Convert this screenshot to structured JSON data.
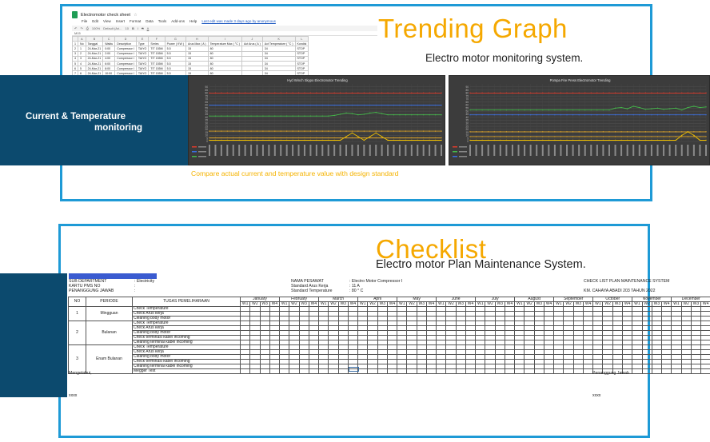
{
  "trending": {
    "title": "Trending Graph",
    "subtitle": "Electro motor monitoring system.",
    "panel_line1": "Current & Temperature",
    "panel_line2": "monitoring",
    "compare_text": "Compare actual current and temperature value with design standard",
    "spreadsheet": {
      "file_title": "Electromotor check sheet",
      "menu": [
        "File",
        "Edit",
        "View",
        "Insert",
        "Format",
        "Data",
        "Tools",
        "Add-ons",
        "Help"
      ],
      "last_edit": "Last edit was made 3 days ago by anonymous",
      "zoom": "100%",
      "font": "Default (Ari...",
      "font_size": "10",
      "cell_ref": "M15",
      "col_letters": [
        "",
        "A",
        "B",
        "C",
        "D",
        "E",
        "F",
        "G",
        "H",
        "I",
        "J",
        "K",
        "L"
      ],
      "headers": [
        "No",
        "Tanggal",
        "Waktu",
        "Description",
        "Type",
        "Series",
        "Power ( KW )",
        "Arus Max ( A )",
        "Temperature Max ( °C )",
        "Act Arus ( A )",
        "Act Temperature ( °C )",
        "Kondisi"
      ],
      "rows": [
        [
          "1",
          "24-Mar-21",
          "0:00",
          "Compressor I",
          "TAIYO",
          "TIT 155M",
          "5.5",
          "15",
          "80",
          "",
          "34",
          "STOP"
        ],
        [
          "2",
          "24-Mar-21",
          "2:00",
          "Compressor I",
          "TAIYO",
          "TIT 155M",
          "5.5",
          "15",
          "80",
          "",
          "34",
          "STOP"
        ],
        [
          "3",
          "24-Mar-21",
          "4:00",
          "Compressor I",
          "TAIYO",
          "TIT 155M",
          "5.5",
          "15",
          "80",
          "",
          "34",
          "STOP"
        ],
        [
          "4",
          "24-Mar-21",
          "6:00",
          "Compressor I",
          "TAIYO",
          "TIT 155M",
          "5.5",
          "15",
          "80",
          "",
          "34",
          "STOP"
        ],
        [
          "5",
          "24-Mar-21",
          "8:00",
          "Compressor I",
          "TAIYO",
          "TIT 155M",
          "5.5",
          "15",
          "80",
          "",
          "34",
          "STOP"
        ],
        [
          "6",
          "24-Mar-21",
          "10:00",
          "Compressor I",
          "TAIYO",
          "TIT 155M",
          "5.5",
          "15",
          "80",
          "",
          "34",
          "STOP"
        ]
      ]
    },
    "charts": [
      {
        "title": "Hyd Winch Skypo Electromotor Trending"
      },
      {
        "title": "Pompa Fire Press Electromotor Trending"
      }
    ]
  },
  "chart_data": [
    {
      "type": "line",
      "title": "Hyd Winch Skypo Electromotor Trending",
      "ylim": [
        0,
        95
      ],
      "y_ticks": [
        0,
        5,
        10,
        15,
        20,
        25,
        30,
        35,
        40,
        45,
        50,
        55,
        60,
        65,
        70,
        75,
        80,
        85,
        90
      ],
      "series": [
        {
          "color": "#e03b2b",
          "values": [
            80,
            80,
            80,
            80,
            80,
            80,
            80,
            80,
            80,
            80,
            80,
            80,
            80,
            80,
            80,
            80,
            80,
            80,
            80,
            80,
            80,
            80,
            80,
            80,
            80,
            80,
            80,
            80,
            80,
            80,
            80,
            80,
            80,
            80,
            80,
            80,
            80,
            80,
            80,
            80
          ]
        },
        {
          "color": "#3a6fe0",
          "values": [
            60,
            60,
            60,
            60,
            60,
            60,
            60,
            60,
            60,
            60,
            60,
            60,
            60,
            60,
            60,
            60,
            60,
            60,
            60,
            60,
            60,
            60,
            60,
            60,
            60,
            60,
            60,
            60,
            60,
            60,
            60,
            60,
            60,
            60,
            60,
            60,
            60,
            60,
            60,
            60
          ]
        },
        {
          "color": "#44b94a",
          "values": [
            42,
            42,
            42,
            42,
            42,
            42,
            42,
            42,
            42,
            42,
            42,
            42,
            42,
            42,
            42,
            42,
            42,
            42,
            42,
            42,
            42,
            43,
            45,
            47,
            46,
            44,
            45,
            47,
            48,
            46,
            44,
            44,
            44,
            44,
            44,
            44,
            44,
            44,
            44,
            44
          ]
        },
        {
          "color": "#d9a12a",
          "values": [
            17,
            17,
            17,
            17,
            17,
            17,
            17,
            17,
            17,
            17,
            17,
            17,
            17,
            17,
            17,
            17,
            17,
            17,
            17,
            17,
            17,
            17,
            17,
            17,
            17,
            17,
            17,
            17,
            17,
            17,
            17,
            17,
            17,
            17,
            17,
            17,
            17,
            17,
            17,
            17
          ]
        },
        {
          "color": "#d9a12a",
          "values": [
            6,
            6,
            6,
            6,
            6,
            6,
            6,
            6,
            6,
            6,
            6,
            6,
            6,
            6,
            6,
            6,
            6,
            6,
            6,
            6,
            6,
            6,
            6,
            6,
            6,
            6,
            6,
            6,
            6,
            6,
            6,
            6,
            6,
            6,
            6,
            6,
            6,
            6,
            6,
            6
          ]
        },
        {
          "color": "#f0c000",
          "values": [
            2,
            2,
            2,
            2,
            2,
            2,
            2,
            2,
            2,
            2,
            2,
            2,
            2,
            2,
            2,
            2,
            2,
            2,
            2,
            2,
            2,
            2,
            2,
            8,
            14,
            8,
            2,
            8,
            14,
            8,
            2,
            2,
            2,
            2,
            2,
            2,
            2,
            2,
            2,
            2
          ]
        }
      ]
    },
    {
      "type": "line",
      "title": "Pompa Fire Press Electromotor Trending",
      "ylim": [
        0,
        95
      ],
      "y_ticks": [
        0,
        5,
        10,
        15,
        20,
        25,
        30,
        35,
        40,
        45,
        50,
        55,
        60,
        65,
        70,
        75,
        80,
        85,
        90
      ],
      "series": [
        {
          "color": "#e03b2b",
          "values": [
            80,
            80,
            80,
            80,
            80,
            80,
            80,
            80,
            80,
            80,
            80,
            80,
            80,
            80,
            80,
            80,
            80,
            80,
            80,
            80,
            80,
            80,
            80,
            80,
            80,
            80,
            80,
            80,
            80,
            80,
            80,
            80,
            80,
            80,
            80,
            80,
            80,
            80,
            80,
            80
          ]
        },
        {
          "color": "#44b94a",
          "values": [
            52,
            52,
            52,
            52,
            52,
            52,
            52,
            52,
            52,
            52,
            52,
            52,
            52,
            52,
            52,
            52,
            52,
            52,
            52,
            52,
            52,
            52,
            52,
            52,
            55,
            56,
            54,
            58,
            56,
            53,
            54,
            55,
            53,
            54,
            55,
            52,
            56,
            58,
            56,
            57
          ]
        },
        {
          "color": "#3a6fe0",
          "values": [
            44,
            44,
            44,
            44,
            44,
            44,
            44,
            44,
            44,
            44,
            44,
            44,
            44,
            44,
            44,
            44,
            44,
            44,
            44,
            44,
            44,
            44,
            44,
            44,
            44,
            44,
            44,
            44,
            44,
            44,
            44,
            44,
            44,
            44,
            44,
            44,
            44,
            44,
            44,
            44
          ]
        },
        {
          "color": "#d9a12a",
          "values": [
            16,
            16,
            16,
            16,
            16,
            16,
            16,
            16,
            16,
            16,
            16,
            16,
            16,
            16,
            16,
            16,
            16,
            16,
            16,
            16,
            16,
            16,
            16,
            16,
            16,
            16,
            16,
            16,
            16,
            16,
            16,
            16,
            16,
            16,
            16,
            16,
            16,
            16,
            16,
            16
          ]
        },
        {
          "color": "#d9a12a",
          "values": [
            8,
            8,
            8,
            8,
            8,
            8,
            8,
            8,
            8,
            8,
            8,
            8,
            8,
            8,
            8,
            8,
            8,
            8,
            8,
            8,
            8,
            8,
            8,
            8,
            8,
            8,
            8,
            8,
            8,
            8,
            8,
            8,
            8,
            8,
            8,
            8,
            8,
            8,
            8,
            8
          ]
        },
        {
          "color": "#f0c000",
          "values": [
            2,
            2,
            2,
            2,
            2,
            2,
            2,
            2,
            2,
            2,
            2,
            2,
            2,
            2,
            2,
            2,
            2,
            2,
            2,
            2,
            2,
            2,
            2,
            2,
            2,
            2,
            2,
            2,
            2,
            2,
            2,
            2,
            2,
            2,
            2,
            10,
            16,
            10,
            2,
            2
          ]
        }
      ]
    }
  ],
  "checklist": {
    "title": "Checklist",
    "subtitle": "Electro motor Plan Maintenance System.",
    "header_left": [
      {
        "label": "SUB DEPARTMENT",
        "value": ": Electricity"
      },
      {
        "label": "KARTU PMS NO",
        "value": ":"
      },
      {
        "label": "PENANGGUNG JAWAB",
        "value": ":"
      }
    ],
    "header_mid": [
      {
        "label": "NAMA PESAWAT",
        "value": ": Electro Motor Compressor I"
      },
      {
        "label": "Standard Arus Kerja",
        "value": ": 11 A"
      },
      {
        "label": "Standard Temperature",
        "value": ": 80 ° C"
      }
    ],
    "header_right_1": "CHECK LIST PLAN MAINTENANCE SYSTEM",
    "header_right_2": "KM. CAHAYA ABADI 203 TAHUN 2022",
    "col_no": "NO",
    "col_periode": "PERIODE",
    "col_tugas": "TUGAS PEMELIHARAAN",
    "months": [
      "January",
      "February",
      "March",
      "April",
      "May",
      "June",
      "July",
      "August",
      "September",
      "October",
      "November",
      "December"
    ],
    "weeks": [
      "W1",
      "W2",
      "W3",
      "W4"
    ],
    "groups": [
      {
        "no": "1",
        "periode": "Mingguan",
        "tasks": [
          "Check Temperature",
          "Check Arus kerja",
          "Cleaning body motor"
        ]
      },
      {
        "no": "2",
        "periode": "Bulanan",
        "tasks": [
          "Check Temperature",
          "Check Arus kerja",
          "Cleaning body motor",
          "Check terminasi kabel incoming",
          "Cleaning terminal kabel incoming"
        ]
      },
      {
        "no": "3",
        "periode": "Enam Bulanan",
        "tasks": [
          "Check Temperature",
          "Check Arus kerja",
          "Cleaning body motor",
          "Check terminasi kabel incoming",
          "Cleaning terminal kabel incoming",
          "Megger Test"
        ]
      }
    ],
    "sign_left_title": "Mengetahui,",
    "sign_left_name": "xxxx",
    "sign_right_title": "Penanggung Jawab",
    "sign_right_name": "xxxx"
  }
}
